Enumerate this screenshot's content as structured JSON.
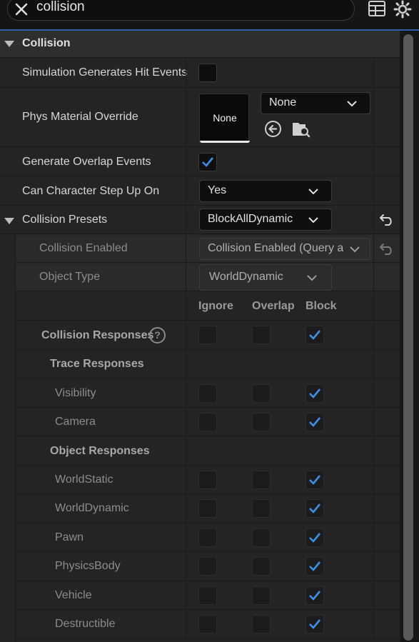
{
  "search": {
    "query": "collision"
  },
  "category": {
    "label": "Collision"
  },
  "properties": {
    "sim_hit_events": "Simulation Generates Hit Events",
    "phys_material_override": "Phys Material Override",
    "phys_material_thumb": "None",
    "phys_material_value": "None",
    "generate_overlap": "Generate Overlap Events",
    "step_up_on": "Can Character Step Up On",
    "step_up_value": "Yes",
    "collision_presets": "Collision Presets",
    "collision_presets_value": "BlockAllDynamic",
    "collision_enabled": "Collision Enabled",
    "collision_enabled_value": "Collision Enabled (Query ar",
    "object_type": "Object Type",
    "object_type_value": "WorldDynamic"
  },
  "response_columns": {
    "ignore": "Ignore",
    "overlap": "Overlap",
    "block": "Block"
  },
  "collision_responses": {
    "label": "Collision Responses",
    "help_glyph": "?",
    "trace_header": "Trace Responses",
    "object_header": "Object Responses",
    "trace": [
      {
        "name": "Visibility",
        "block": true
      },
      {
        "name": "Camera",
        "block": true
      }
    ],
    "object": [
      {
        "name": "WorldStatic",
        "block": true
      },
      {
        "name": "WorldDynamic",
        "block": true
      },
      {
        "name": "Pawn",
        "block": true
      },
      {
        "name": "PhysicsBody",
        "block": true
      },
      {
        "name": "Vehicle",
        "block": true
      },
      {
        "name": "Destructible",
        "block": true
      }
    ]
  },
  "colors": {
    "accent": "#2f5fa8",
    "check": "#3f8ee8"
  }
}
